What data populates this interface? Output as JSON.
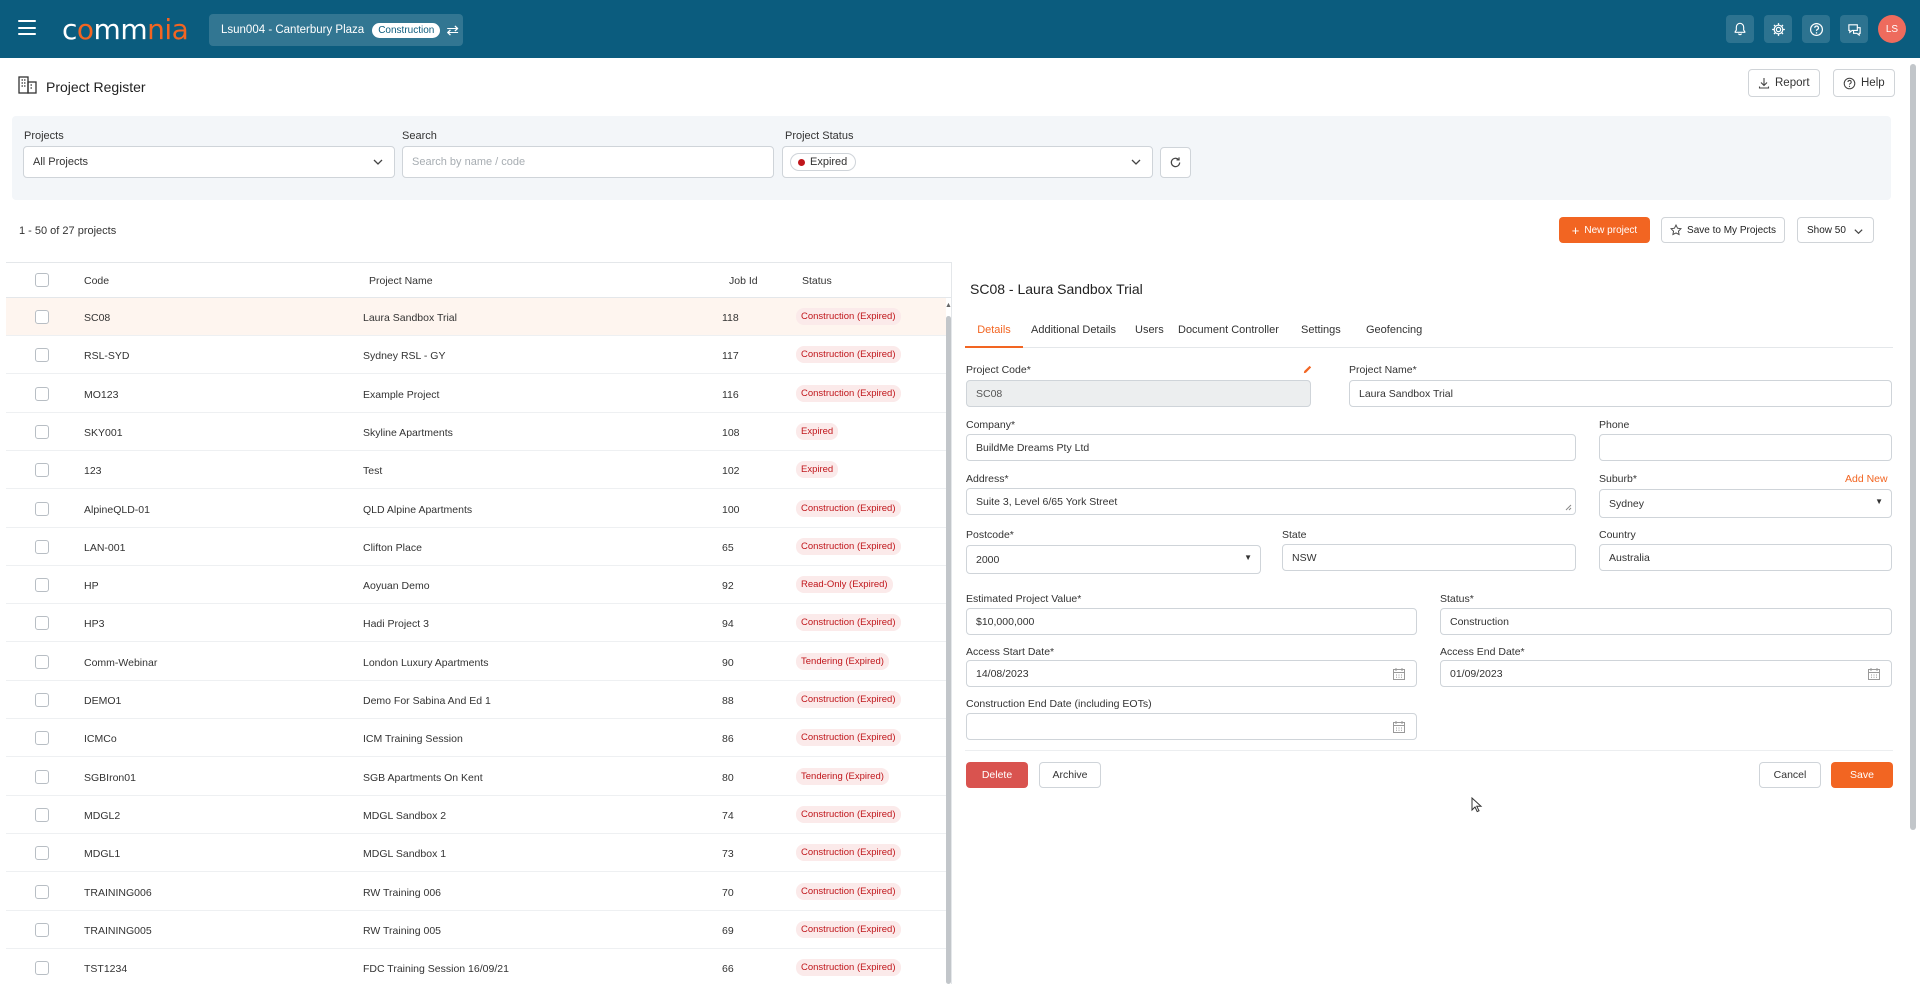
{
  "topbar": {
    "logo": {
      "part1": "c",
      "o1": "o",
      "part2": "mm",
      "part3": "nia"
    },
    "project_switch": {
      "label": "Lsun004 - Canterbury Plaza",
      "badge": "Construction"
    },
    "avatar_initials": "LS"
  },
  "header": {
    "title": "Project Register",
    "report_label": "Report",
    "help_label": "Help"
  },
  "filters": {
    "projects_label": "Projects",
    "projects_value": "All Projects",
    "search_label": "Search",
    "search_placeholder": "Search by name / code",
    "status_label": "Project Status",
    "status_value": "Expired"
  },
  "toolbar": {
    "count": "1 - 50 of 27 projects",
    "new_project": "New project",
    "save_to_my": "Save to My Projects",
    "show": "Show 50"
  },
  "table": {
    "headers": {
      "code": "Code",
      "name": "Project Name",
      "job": "Job Id",
      "status": "Status"
    },
    "rows": [
      {
        "code": "SC08",
        "name": "Laura Sandbox Trial",
        "job": "118",
        "status": "Construction (Expired)"
      },
      {
        "code": "RSL-SYD",
        "name": "Sydney RSL - GY",
        "job": "117",
        "status": "Construction (Expired)"
      },
      {
        "code": "MO123",
        "name": "Example Project",
        "job": "116",
        "status": "Construction (Expired)"
      },
      {
        "code": "SKY001",
        "name": "Skyline Apartments",
        "job": "108",
        "status": "Expired"
      },
      {
        "code": "123",
        "name": "Test",
        "job": "102",
        "status": "Expired"
      },
      {
        "code": "AlpineQLD-01",
        "name": "QLD Alpine Apartments",
        "job": "100",
        "status": "Construction (Expired)"
      },
      {
        "code": "LAN-001",
        "name": "Clifton Place",
        "job": "65",
        "status": "Construction (Expired)"
      },
      {
        "code": "HP",
        "name": "Aoyuan Demo",
        "job": "92",
        "status": "Read-Only (Expired)"
      },
      {
        "code": "HP3",
        "name": "Hadi Project 3",
        "job": "94",
        "status": "Construction (Expired)"
      },
      {
        "code": "Comm-Webinar",
        "name": "London Luxury Apartments",
        "job": "90",
        "status": "Tendering (Expired)"
      },
      {
        "code": "DEMO1",
        "name": "Demo For Sabina And Ed 1",
        "job": "88",
        "status": "Construction (Expired)"
      },
      {
        "code": "ICMCo",
        "name": "ICM Training Session",
        "job": "86",
        "status": "Construction (Expired)"
      },
      {
        "code": "SGBIron01",
        "name": "SGB Apartments On Kent",
        "job": "80",
        "status": "Tendering (Expired)"
      },
      {
        "code": "MDGL2",
        "name": "MDGL Sandbox 2",
        "job": "74",
        "status": "Construction (Expired)"
      },
      {
        "code": "MDGL1",
        "name": "MDGL Sandbox 1",
        "job": "73",
        "status": "Construction (Expired)"
      },
      {
        "code": "TRAINING006",
        "name": "RW Training 006",
        "job": "70",
        "status": "Construction (Expired)"
      },
      {
        "code": "TRAINING005",
        "name": "RW Training 005",
        "job": "69",
        "status": "Construction (Expired)"
      },
      {
        "code": "TST1234",
        "name": "FDC Training Session 16/09/21",
        "job": "66",
        "status": "Construction (Expired)"
      }
    ]
  },
  "detail": {
    "title": "SC08 - Laura Sandbox Trial",
    "tabs": [
      "Details",
      "Additional Details",
      "Users",
      "Document Controller",
      "Settings",
      "Geofencing"
    ],
    "labels": {
      "project_code": "Project Code*",
      "project_name": "Project Name*",
      "company": "Company*",
      "phone": "Phone",
      "address": "Address*",
      "suburb": "Suburb*",
      "add_new": "Add New",
      "postcode": "Postcode*",
      "state": "State",
      "country": "Country",
      "est_value": "Estimated Project Value*",
      "status": "Status*",
      "access_start": "Access Start Date*",
      "access_end": "Access End Date*",
      "construction_end": "Construction End Date (including EOTs)"
    },
    "values": {
      "project_code": "SC08",
      "project_name": "Laura Sandbox Trial",
      "company": "BuildMe Dreams Pty Ltd",
      "phone": "",
      "address": "Suite 3, Level 6/65 York Street",
      "suburb": "Sydney",
      "postcode": "2000",
      "state": "NSW",
      "country": "Australia",
      "est_value": "$10,000,000",
      "status": "Construction",
      "access_start": "14/08/2023",
      "access_end": "01/09/2023",
      "construction_end": ""
    },
    "buttons": {
      "delete": "Delete",
      "archive": "Archive",
      "cancel": "Cancel",
      "save": "Save"
    }
  },
  "colors": {
    "topbar": "#0b5c7e",
    "accent": "#f26522",
    "danger": "#d9534f",
    "expired": "#c0161b"
  }
}
